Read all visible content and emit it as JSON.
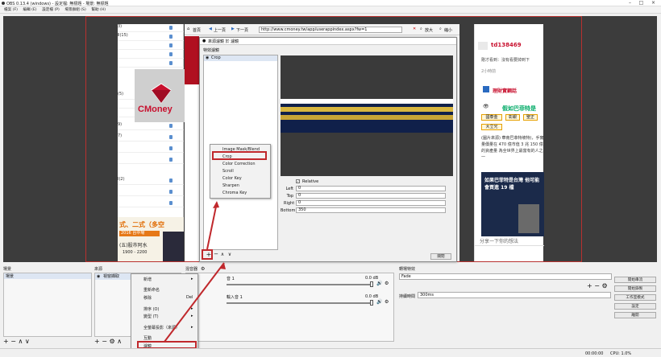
{
  "window": {
    "title": "OBS 0.13.4 (windows) - 設定檔: 無標題 - 場景: 無標題"
  },
  "menu": [
    "檔案 (F)",
    "編輯 (E)",
    "設定檔 (P)",
    "場景群組 (S)",
    "幫助 (H)"
  ],
  "browser": {
    "home": "首頁",
    "prev": "上一頁",
    "next": "下一頁",
    "url": "http://www.cmoney.tw/app/userappindex.aspx?fw=1",
    "zoom": "放大",
    "shrink": "縮小",
    "side_user": "td138469",
    "side_text1": "剛才看到：沒有看要掉到下",
    "side_time1": "2小時前",
    "side_card": "理財實鋼話",
    "side_card2": "假如巴菲特是",
    "tags": [
      "國泰金",
      "彰銀",
      "聖正",
      "大立光"
    ],
    "side_body": "(圖片來源) 華南巴菲特坡特)，手實量價量在 470 億市值 3 兆 150 億的資產量 為全世界上最富有的人之一",
    "side_ad": "如果巴菲特是台灣 他可能會買進 19 檔",
    "share": "分享一下你的想法",
    "tablename_rows": [
      "3)",
      "Ⅱ(15)",
      "",
      "",
      "",
      "",
      "",
      "",
      "",
      "(5)",
      "",
      "",
      "",
      "9)",
      "7)",
      "",
      "",
      "",
      "",
      "I(2)",
      "",
      "",
      "",
      "",
      "",
      "",
      "",
      ""
    ],
    "logo": "CMoney",
    "banner1": "式、二式（多空",
    "banner2": "2016 台中場",
    "banner3": "(五)股市阿水",
    "banner4": "1900 - 2200"
  },
  "filter_dialog": {
    "title": "來源濾鏡 於 濾鏡",
    "filters_label": "特效濾鏡",
    "item": "Crop",
    "relative": "Relative",
    "fields": [
      {
        "label": "Left",
        "value": "0"
      },
      {
        "label": "Top",
        "value": "0"
      },
      {
        "label": "Right",
        "value": "0"
      },
      {
        "label": "Bottom",
        "value": "350"
      }
    ],
    "close": "關閉"
  },
  "filter_menu": [
    "Image Mask/Blend",
    "Crop",
    "Color Correction",
    "Scroll",
    "Color Key",
    "Sharpen",
    "Chroma Key"
  ],
  "scenes": {
    "title": "場景",
    "item": "場景"
  },
  "sources": {
    "title": "來源",
    "item": "視窗擷取"
  },
  "source_menu": [
    {
      "label": "新增",
      "shortcut": "",
      "arrow": "▸"
    },
    {
      "label": "重新命名",
      "shortcut": "",
      "arrow": ""
    },
    {
      "label": "移除",
      "shortcut": "Del",
      "arrow": ""
    },
    {
      "label": "排序 (O)",
      "shortcut": "",
      "arrow": "▸"
    },
    {
      "label": "變型 (T)",
      "shortcut": "",
      "arrow": "▸"
    },
    {
      "label": "全螢幕投影（來源）",
      "shortcut": "",
      "arrow": "▸"
    },
    {
      "label": "互動",
      "shortcut": "",
      "arrow": ""
    },
    {
      "label": "濾鏡",
      "shortcut": "",
      "arrow": ""
    },
    {
      "label": "屬性",
      "shortcut": "",
      "arrow": ""
    }
  ],
  "mixer": {
    "title": "混音器",
    "ch1": "音 1",
    "ch1_db": "0.0 dB",
    "ch2": "輸入音 1",
    "ch2_db": "0.0 dB"
  },
  "transitions": {
    "title": "轉場特效",
    "select": "Fade",
    "duration_label": "持續時間",
    "duration": "300ms"
  },
  "controls": [
    "開始串流",
    "開始錄製",
    "工作室模式",
    "設定",
    "離開"
  ],
  "status": {
    "time": "00:00:00",
    "cpu": "CPU: 1.0%"
  },
  "colors": {
    "accent_red": "#c0282c",
    "preview_bg": "#3c3c3c",
    "cmoney_red": "#c8102e"
  }
}
